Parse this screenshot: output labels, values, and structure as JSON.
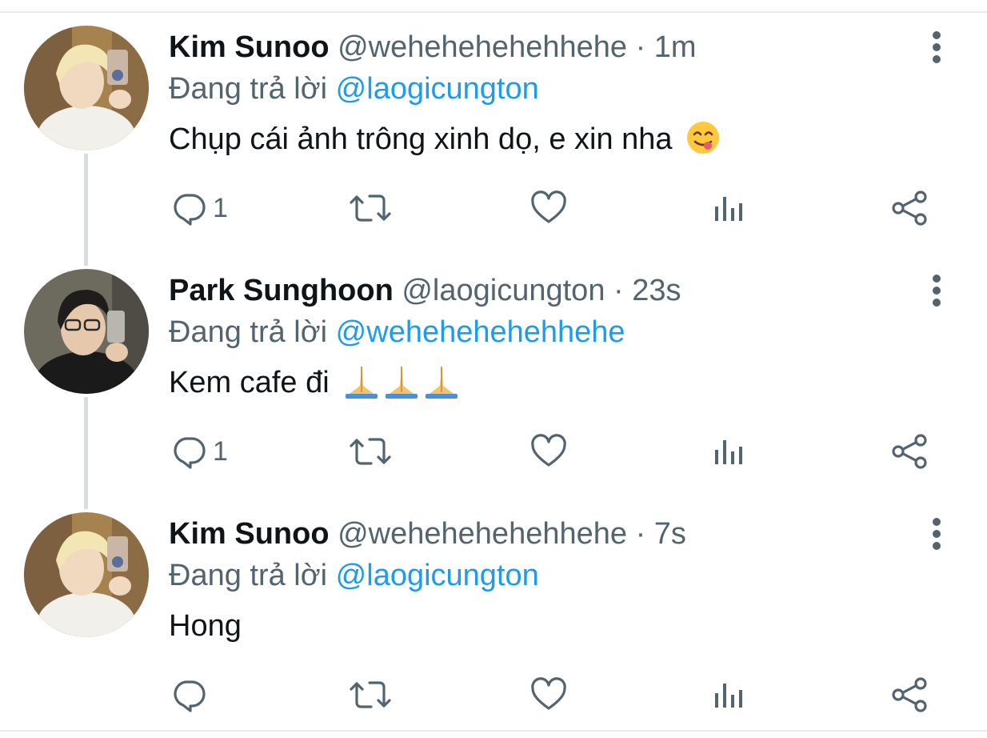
{
  "colors": {
    "text": "#0f1419",
    "secondary": "#536471",
    "mention": "#1d9bf0",
    "divider": "#e7e9ea",
    "thread_line": "#d8dde1"
  },
  "tweets": [
    {
      "display_name": "Kim Sunoo",
      "handle": "@wehehehehehhehe",
      "separator": "·",
      "time": "1m",
      "reply_prefix": "Đang trả lời",
      "reply_to": "@laogicungton",
      "text": "Chụp cái ảnh trông xinh dọ, e xin nha",
      "emoji": "face-savoring-food-emoji",
      "reply_count": "1",
      "avatar": "kim-sunoo-avatar"
    },
    {
      "display_name": "Park Sunghoon",
      "handle": "@laogicungton",
      "separator": "·",
      "time": "23s",
      "reply_prefix": "Đang trả lời",
      "reply_to": "@wehehehehehhehe",
      "text": "Kem cafe đi",
      "emoji": "folded-hands-emoji x3",
      "reply_count": "1",
      "avatar": "park-sunghoon-avatar"
    },
    {
      "display_name": "Kim Sunoo",
      "handle": "@wehehehehehhehe",
      "separator": "·",
      "time": "7s",
      "reply_prefix": "Đang trả lời",
      "reply_to": "@laogicungton",
      "text": "Hong",
      "emoji": "",
      "reply_count": "",
      "avatar": "kim-sunoo-avatar"
    }
  ],
  "icons": {
    "reply": "reply-icon",
    "retweet": "retweet-icon",
    "like": "heart-icon",
    "views": "analytics-icon",
    "share": "share-icon",
    "more": "more-vertical-icon"
  }
}
